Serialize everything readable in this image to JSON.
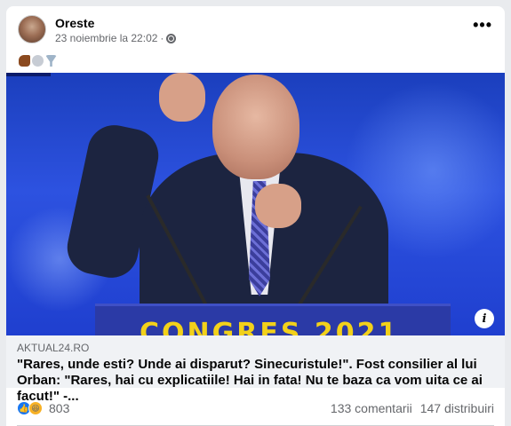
{
  "post": {
    "author": "Oreste",
    "timestamp": "23 noiembrie la 22:02",
    "separator": "·",
    "more_label": "•••",
    "emojis": [
      "horse-emoji",
      "tornado-emoji",
      "funnel-emoji"
    ]
  },
  "image": {
    "podium_text": "CONGRES 2021",
    "info_label": "i"
  },
  "link": {
    "domain": "AKTUAL24.RO",
    "title": "\"Rares, unde esti? Unde ai disparut? Sinecuristule!\". Fost consilier al lui Orban: \"Rares, hai cu explicatiile! Hai in fata! Nu te baza ca vom uita ce ai facut!\" -..."
  },
  "stats": {
    "reaction_count": "803",
    "comments": "133 comentarii",
    "shares": "147 distribuiri"
  },
  "colors": {
    "accent": "#1877f2",
    "haha": "#f7b125",
    "image_bg": "#2d52e0",
    "podium_text": "#f2d11a"
  }
}
